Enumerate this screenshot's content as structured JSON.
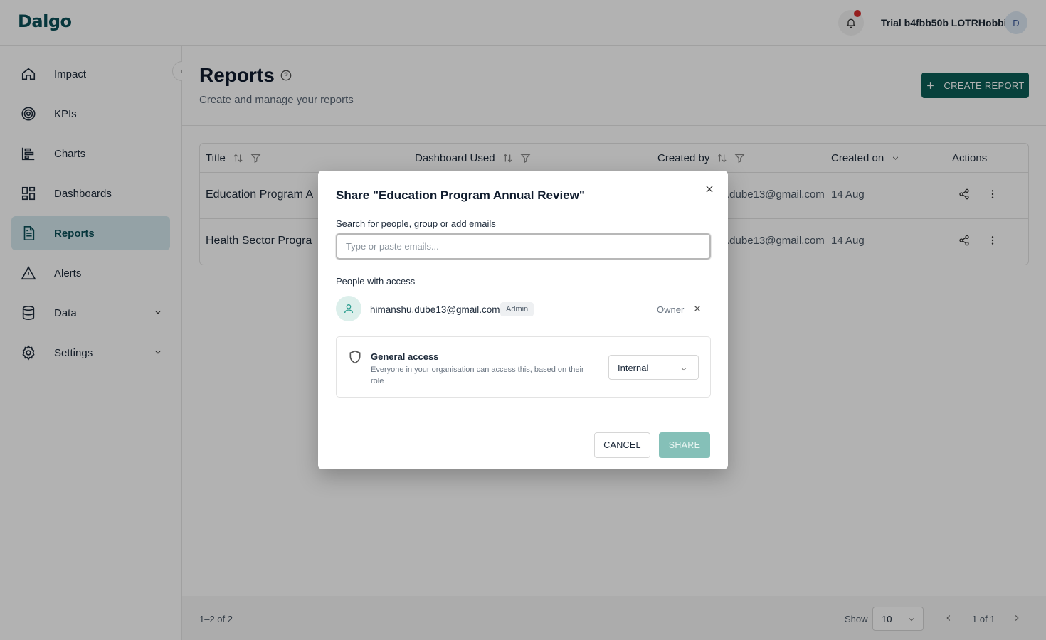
{
  "header": {
    "logo": "Dalgo",
    "user_name": "Trial b4fbb50b LOTRHobbit",
    "avatar_initial": "D"
  },
  "sidebar": {
    "items": [
      {
        "label": "Impact",
        "icon": "home-icon"
      },
      {
        "label": "KPIs",
        "icon": "target-icon"
      },
      {
        "label": "Charts",
        "icon": "bar-chart-icon"
      },
      {
        "label": "Dashboards",
        "icon": "dashboard-icon"
      },
      {
        "label": "Reports",
        "icon": "document-icon",
        "active": true
      },
      {
        "label": "Alerts",
        "icon": "warning-icon"
      },
      {
        "label": "Data",
        "icon": "database-icon",
        "expandable": true
      },
      {
        "label": "Settings",
        "icon": "gear-icon",
        "expandable": true
      }
    ]
  },
  "page": {
    "title": "Reports",
    "subtitle": "Create and manage your reports",
    "create_button": "CREATE REPORT"
  },
  "table": {
    "columns": [
      "Title",
      "Dashboard Used",
      "Created by",
      "Created on",
      "Actions"
    ],
    "rows": [
      {
        "title": "Education Program A",
        "created_by": ".dube13@gmail.com",
        "created_on": "14 Aug"
      },
      {
        "title": "Health Sector Progra",
        "created_by": ".dube13@gmail.com",
        "created_on": "14 Aug"
      }
    ]
  },
  "footer": {
    "count": "1–2 of 2",
    "show_label": "Show",
    "page_size": "10",
    "page_indicator": "1 of 1"
  },
  "modal": {
    "title": "Share \"Education Program Annual Review\"",
    "search_label": "Search for people, group or add emails",
    "search_placeholder": "Type or paste emails...",
    "search_value": "",
    "people_label": "People with access",
    "person": {
      "email": "himanshu.dube13@gmail.com",
      "badge": "Admin",
      "role": "Owner"
    },
    "general_access": {
      "title": "General access",
      "description": "Everyone in your organisation can access this, based on their role",
      "selected": "Internal"
    },
    "cancel_label": "CANCEL",
    "share_label": "SHARE"
  },
  "colors": {
    "brand": "#0b5d56",
    "share_disabled": "#85c0b8",
    "active_nav_bg": "#d4e8ee",
    "notification_dot": "#d62b2b"
  }
}
